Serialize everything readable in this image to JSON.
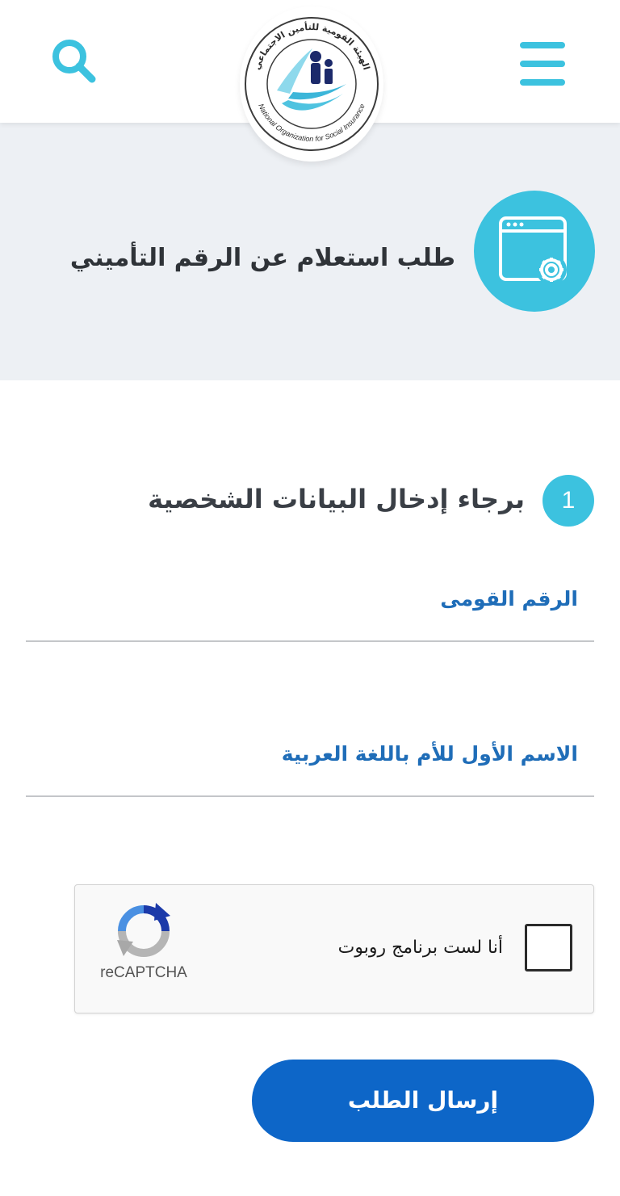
{
  "header": {
    "menu_icon": "hamburger-menu-icon",
    "search_icon": "search-icon",
    "logo": {
      "text_ar": "الهيئة القومية للتأمين الاجتماعي",
      "text_en": "National Organization for Social Insurance"
    }
  },
  "hero": {
    "title": "طلب استعلام عن الرقم التأميني",
    "icon": "browser-settings-icon"
  },
  "step": {
    "number": "1",
    "title": "برجاء إدخال البيانات الشخصية"
  },
  "form": {
    "national_id_label": "الرقم القومى",
    "mother_name_label": "الاسم الأول للأم باللغة العربية"
  },
  "captcha": {
    "label": "أنا لست برنامج روبوت",
    "brand": "reCAPTCHA"
  },
  "submit": {
    "label": "إرسال الطلب"
  },
  "colors": {
    "accent": "#3cc2df",
    "primary_blue": "#0d66c8",
    "label_blue": "#1f6db8",
    "hero_bg": "#edf0f4"
  }
}
